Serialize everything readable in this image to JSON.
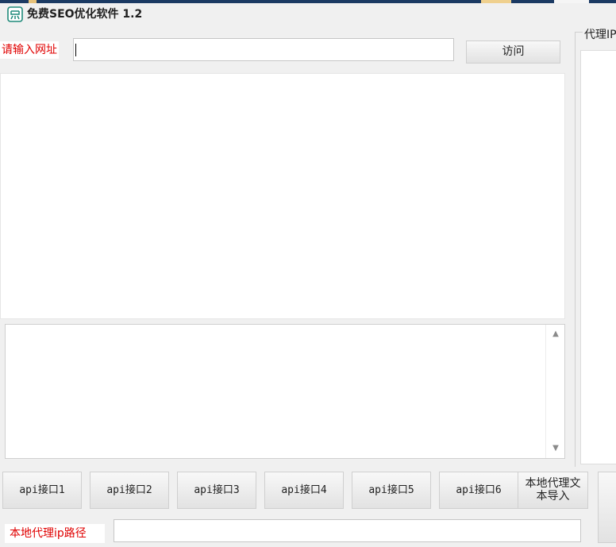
{
  "window": {
    "title": "免费SEO优化软件 1.2"
  },
  "url_bar": {
    "label": "请输入网址",
    "value": "",
    "visit_button": "访问"
  },
  "proxy_panel": {
    "title": "代理IP"
  },
  "api_buttons": [
    "api接口1",
    "api接口2",
    "api接口3",
    "api接口4",
    "api接口5",
    "api接口6"
  ],
  "import_button": {
    "line1": "本地代理文",
    "line2": "本导入"
  },
  "local_path": {
    "label": "本地代理ip路径",
    "value": ""
  },
  "colors": {
    "label_red": "#e00000",
    "icon_green": "#1f8a7a",
    "window_bg": "#f0f0f0"
  },
  "icons": {
    "app": "app-logo-icon",
    "scroll_up": "scroll-up-arrow-icon",
    "scroll_down": "scroll-down-arrow-icon"
  }
}
